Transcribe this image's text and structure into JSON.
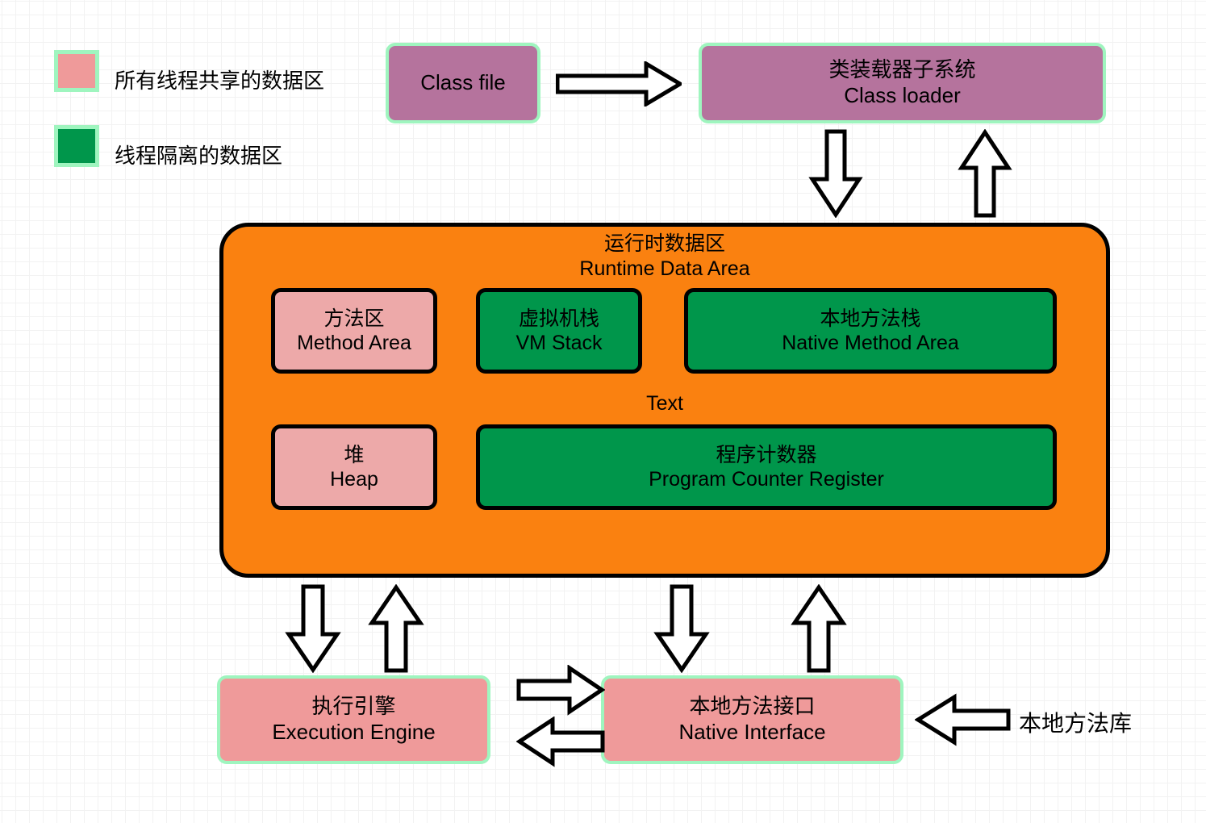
{
  "diagram": {
    "title_cn": "运行时数据区",
    "title_en": "Runtime Data Area",
    "text_label": "Text"
  },
  "legend": {
    "items": [
      {
        "label": "所有线程共享的数据区",
        "color": "#ef9a9a",
        "border": "#9ff5bf"
      },
      {
        "label": "线程隔离的数据区",
        "color": "#00964b",
        "border": "#9ff5bf"
      }
    ]
  },
  "nodes": {
    "class_file": {
      "label_en": "Class file",
      "color": "#b5739d"
    },
    "class_loader": {
      "label_cn": "类装载器子系统",
      "label_en": "Class loader",
      "color": "#b5739d"
    },
    "method_area": {
      "label_cn": "方法区",
      "label_en": "Method Area",
      "color": "#eda9a9"
    },
    "vm_stack": {
      "label_cn": "虚拟机栈",
      "label_en": "VM Stack",
      "color": "#00964b"
    },
    "native_method_area": {
      "label_cn": "本地方法栈",
      "label_en": "Native Method Area",
      "color": "#00964b"
    },
    "heap": {
      "label_cn": "堆",
      "label_en": "Heap",
      "color": "#eda9a9"
    },
    "program_counter": {
      "label_cn": "程序计数器",
      "label_en": "Program Counter Register",
      "color": "#00964b"
    },
    "execution_engine": {
      "label_cn": "执行引擎",
      "label_en": "Execution Engine",
      "color": "#ef9a9a"
    },
    "native_interface": {
      "label_cn": "本地方法接口",
      "label_en": "Native Interface",
      "color": "#ef9a9a"
    },
    "native_library": {
      "label_cn": "本地方法库"
    }
  },
  "colors": {
    "background": "#ffffff",
    "grid_minor": "#f2f2f2",
    "grid_major": "#c9c9c9",
    "runtime_area": "#fa8110",
    "shared_pink": "#ef9a9a",
    "isolated_green": "#00964b",
    "mauve": "#b5739d",
    "green_border": "#9ff5bf",
    "outline": "#000000"
  },
  "arrows": [
    {
      "name": "class-file-to-class-loader",
      "direction": "right"
    },
    {
      "name": "class-loader-to-runtime-data-area",
      "direction": "down"
    },
    {
      "name": "runtime-data-area-to-class-loader",
      "direction": "up"
    },
    {
      "name": "runtime-data-area-to-execution-engine",
      "direction": "down"
    },
    {
      "name": "execution-engine-to-runtime-data-area",
      "direction": "up"
    },
    {
      "name": "runtime-data-area-to-native-interface",
      "direction": "down"
    },
    {
      "name": "native-interface-to-runtime-data-area",
      "direction": "up"
    },
    {
      "name": "execution-engine-to-native-interface",
      "direction": "right"
    },
    {
      "name": "native-interface-to-execution-engine",
      "direction": "left"
    },
    {
      "name": "native-library-to-native-interface",
      "direction": "left"
    }
  ]
}
